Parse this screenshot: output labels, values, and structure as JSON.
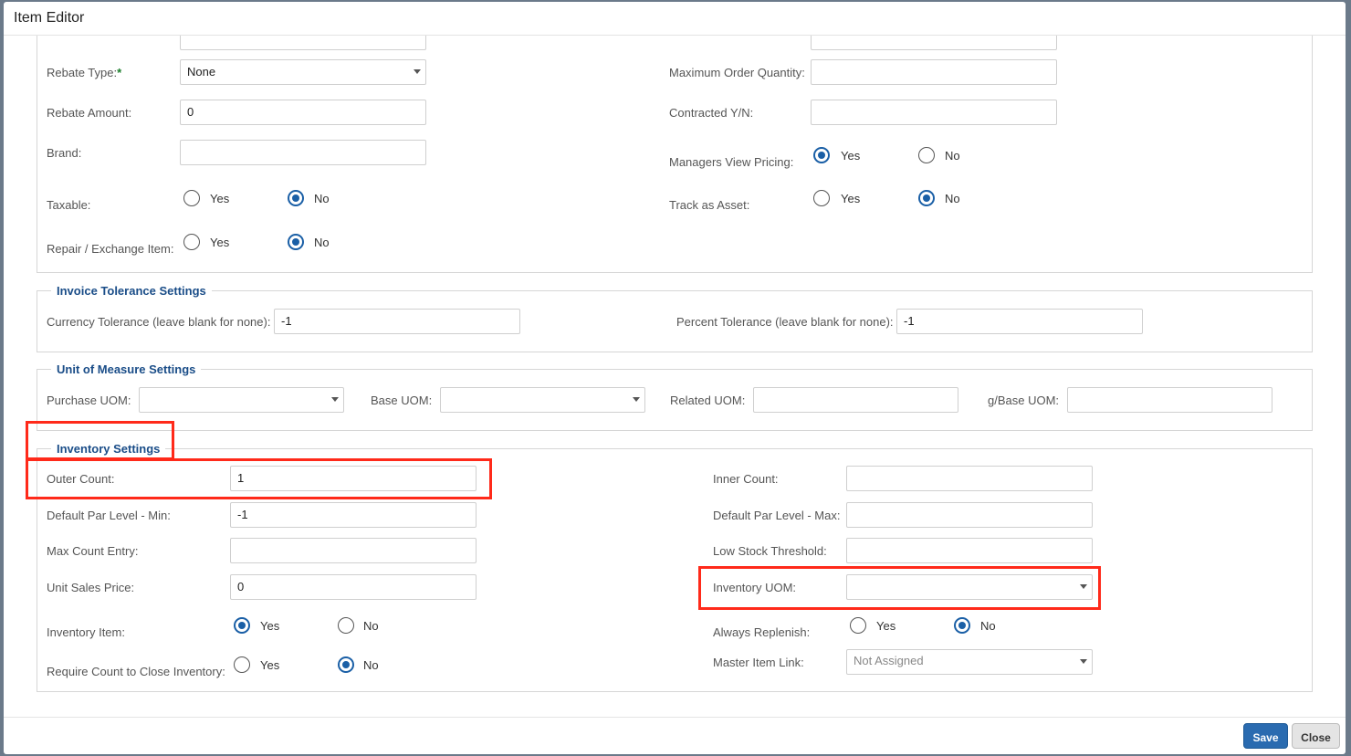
{
  "modal": {
    "title": "Item Editor",
    "save_label": "Save",
    "close_label": "Close"
  },
  "general": {
    "rebate_type": {
      "label": "Rebate Type:",
      "required_mark": "*",
      "value": "None"
    },
    "rebate_amount": {
      "label": "Rebate Amount:",
      "value": "0"
    },
    "brand": {
      "label": "Brand:",
      "value": ""
    },
    "taxable": {
      "label": "Taxable:",
      "yes": "Yes",
      "no": "No",
      "selected": "No"
    },
    "repair_exchange": {
      "label": "Repair / Exchange Item:",
      "yes": "Yes",
      "no": "No",
      "selected": "No"
    },
    "max_order_qty": {
      "label": "Maximum Order Quantity:",
      "value": ""
    },
    "contracted": {
      "label": "Contracted Y/N:",
      "value": ""
    },
    "managers_view_pricing": {
      "label": "Managers View Pricing:",
      "yes": "Yes",
      "no": "No",
      "selected": "Yes"
    },
    "track_as_asset": {
      "label": "Track as Asset:",
      "yes": "Yes",
      "no": "No",
      "selected": "No"
    }
  },
  "invoice_tolerance": {
    "legend": "Invoice Tolerance Settings",
    "currency": {
      "label": "Currency Tolerance (leave blank for none):",
      "value": "-1"
    },
    "percent": {
      "label": "Percent Tolerance (leave blank for none):",
      "value": "-1"
    }
  },
  "uom": {
    "legend": "Unit of Measure Settings",
    "purchase": {
      "label": "Purchase UOM:",
      "value": ""
    },
    "base": {
      "label": "Base UOM:",
      "value": ""
    },
    "related": {
      "label": "Related UOM:",
      "value": ""
    },
    "g_base": {
      "label": "g/Base UOM:",
      "value": ""
    }
  },
  "inventory": {
    "legend": "Inventory Settings",
    "outer_count": {
      "label": "Outer Count:",
      "value": "1"
    },
    "par_min": {
      "label": "Default Par Level - Min:",
      "value": "-1"
    },
    "max_count_entry": {
      "label": "Max Count Entry:",
      "value": ""
    },
    "unit_sales_price": {
      "label": "Unit Sales Price:",
      "value": "0"
    },
    "inventory_item": {
      "label": "Inventory Item:",
      "yes": "Yes",
      "no": "No",
      "selected": "Yes"
    },
    "require_count": {
      "label": "Require Count to Close Inventory:",
      "yes": "Yes",
      "no": "No",
      "selected": "No"
    },
    "inner_count": {
      "label": "Inner Count:",
      "value": ""
    },
    "par_max": {
      "label": "Default Par Level - Max:",
      "value": ""
    },
    "low_stock": {
      "label": "Low Stock Threshold:",
      "value": ""
    },
    "inventory_uom": {
      "label": "Inventory UOM:",
      "value": ""
    },
    "always_replenish": {
      "label": "Always Replenish:",
      "yes": "Yes",
      "no": "No",
      "selected": "No"
    },
    "master_item_link": {
      "label": "Master Item Link:",
      "value": "Not Assigned"
    }
  },
  "colors": {
    "highlight": "#ff2a1a",
    "accent": "#1a5fa6",
    "legend": "#1a4d88"
  }
}
